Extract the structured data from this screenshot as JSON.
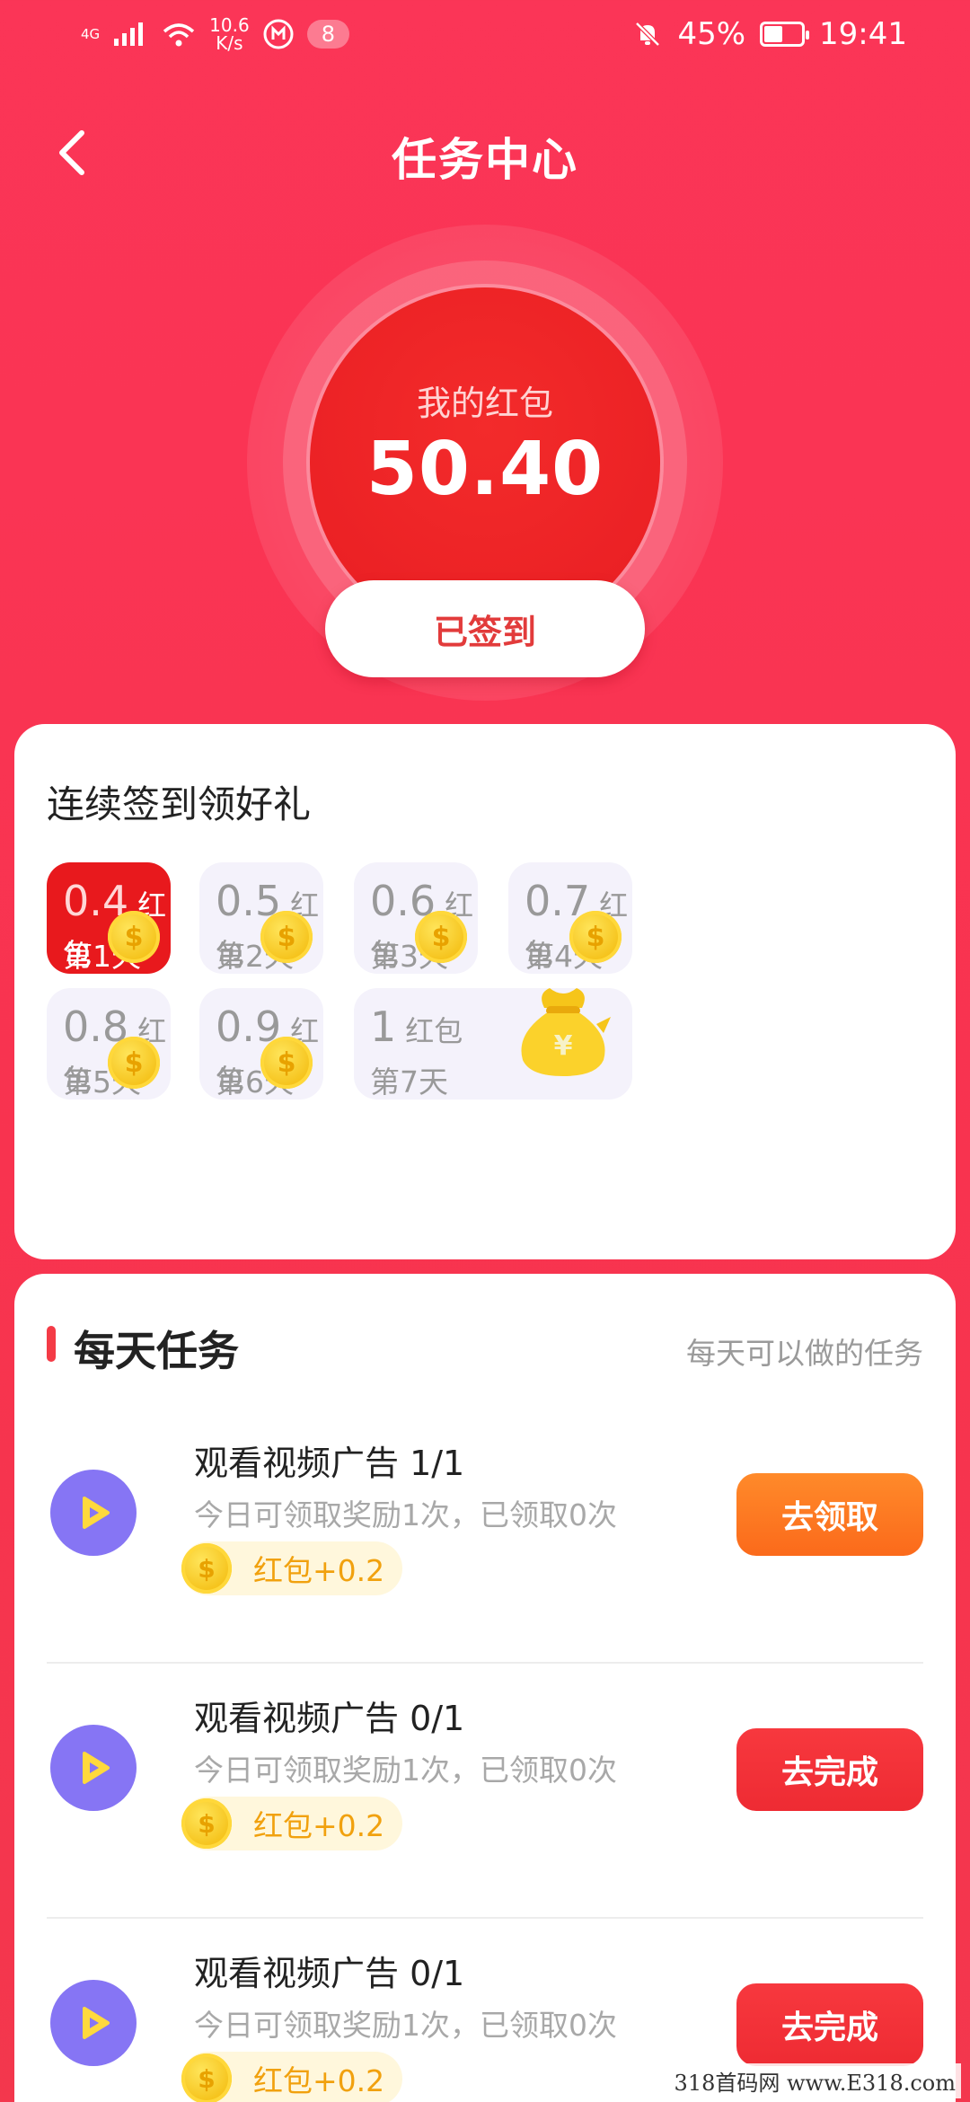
{
  "status_bar": {
    "signal": "4G",
    "net_speed_value": "10.6",
    "net_speed_unit": "K/s",
    "notif_count": "8",
    "battery": "45%",
    "time": "19:41"
  },
  "header": {
    "title": "任务中心"
  },
  "hero": {
    "label": "我的红包",
    "amount": "50.40",
    "signed_label": "已签到"
  },
  "checkin": {
    "title": "连续签到领好礼",
    "days": [
      {
        "amount": "0.4",
        "unit": "红包",
        "day": "第1天",
        "active": true
      },
      {
        "amount": "0.5",
        "unit": "红包",
        "day": "第2天",
        "active": false
      },
      {
        "amount": "0.6",
        "unit": "红包",
        "day": "第3天",
        "active": false
      },
      {
        "amount": "0.7",
        "unit": "红包",
        "day": "第4天",
        "active": false
      },
      {
        "amount": "0.8",
        "unit": "红包",
        "day": "第5天",
        "active": false
      },
      {
        "amount": "0.9",
        "unit": "红包",
        "day": "第6天",
        "active": false
      },
      {
        "amount": "1",
        "unit": "红包",
        "day": "第7天",
        "active": false
      }
    ]
  },
  "tasks": {
    "title": "每天任务",
    "subtitle": "每天可以做的任务",
    "items": [
      {
        "title": "观看视频广告 1/1",
        "desc": "今日可领取奖励1次，已领取0次",
        "reward": "红包+0.2",
        "button": "去领取"
      },
      {
        "title": "观看视频广告 0/1",
        "desc": "今日可领取奖励1次，已领取0次",
        "reward": "红包+0.2",
        "button": "去完成"
      },
      {
        "title": "观看视频广告 0/1",
        "desc": "今日可领取奖励1次，已领取0次",
        "reward": "红包+0.2",
        "button": "去完成"
      }
    ]
  },
  "watermark": "318首码网 www.E318.com",
  "colors": {
    "primary": "#f8334f",
    "active_day": "#e8191d",
    "claim_button": "#fb6a1b",
    "do_button": "#ee2b33",
    "play_icon_bg": "#8675f4",
    "coin": "#f5c21a"
  },
  "icons": {
    "back": "chevron-left-icon",
    "coin": "coin-icon",
    "moneybag": "money-bag-icon",
    "play": "play-icon",
    "mute": "bell-off-icon",
    "wifi": "wifi-icon",
    "battery": "battery-charging-icon"
  }
}
